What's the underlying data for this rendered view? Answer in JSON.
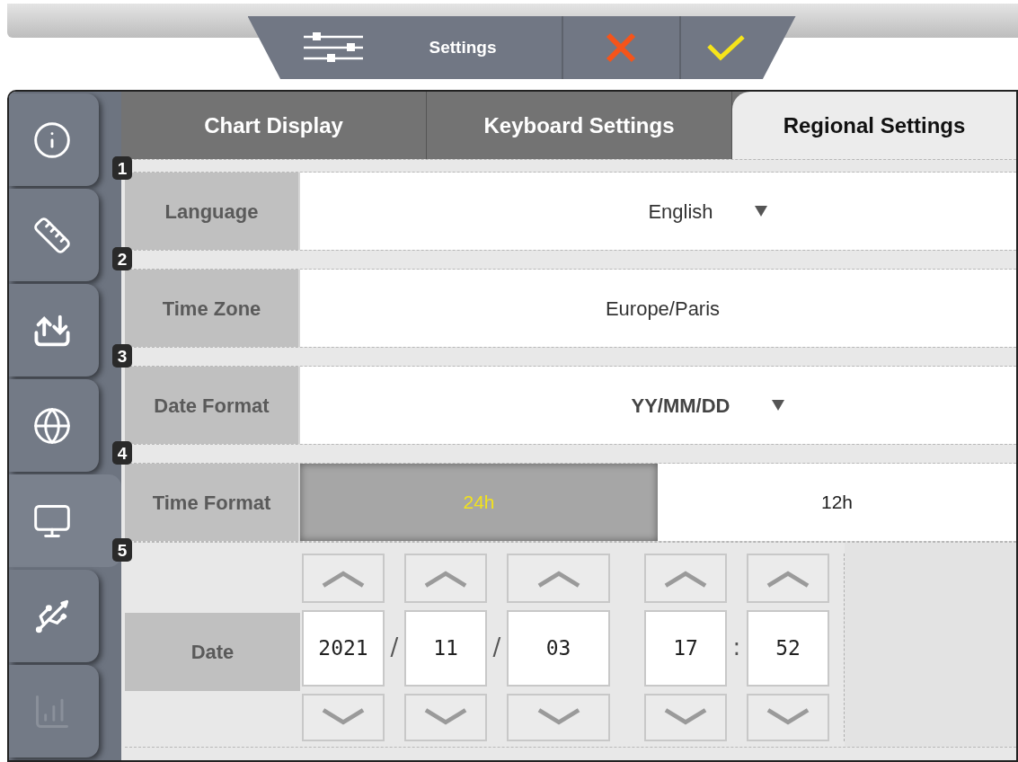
{
  "header": {
    "title": "Settings"
  },
  "sidebar": {
    "items": [
      {
        "selected": false,
        "disabled": false
      },
      {
        "selected": false,
        "disabled": false
      },
      {
        "selected": false,
        "disabled": false
      },
      {
        "selected": false,
        "disabled": false
      },
      {
        "selected": true,
        "disabled": false
      },
      {
        "selected": false,
        "disabled": false
      },
      {
        "selected": false,
        "disabled": true
      }
    ]
  },
  "tabs": [
    {
      "label": "Chart Display",
      "selected": false
    },
    {
      "label": "Keyboard Settings",
      "selected": false
    },
    {
      "label": "Regional Settings",
      "selected": true
    }
  ],
  "rows": [
    {
      "number": "1",
      "label": "Language",
      "kind": "dropdown",
      "value": "English",
      "bold": false
    },
    {
      "number": "2",
      "label": "Time Zone",
      "kind": "text",
      "value": "Europe/Paris"
    },
    {
      "number": "3",
      "label": "Date Format",
      "kind": "dropdown",
      "value": "YY/MM/DD",
      "bold": true
    },
    {
      "number": "4",
      "label": "Time Format",
      "kind": "toggle",
      "options": [
        {
          "label": "24h",
          "selected": true
        },
        {
          "label": "12h",
          "selected": false
        }
      ]
    },
    {
      "number": "5",
      "label": "Date",
      "kind": "datetime",
      "parts": [
        {
          "kind": "field",
          "value": "2021"
        },
        {
          "kind": "separator",
          "text": "/"
        },
        {
          "kind": "field",
          "value": "11"
        },
        {
          "kind": "separator",
          "text": "/"
        },
        {
          "kind": "field",
          "value": "03"
        },
        {
          "kind": "field",
          "value": "17"
        },
        {
          "kind": "separator",
          "text": ":"
        },
        {
          "kind": "field",
          "value": "52"
        }
      ]
    }
  ]
}
